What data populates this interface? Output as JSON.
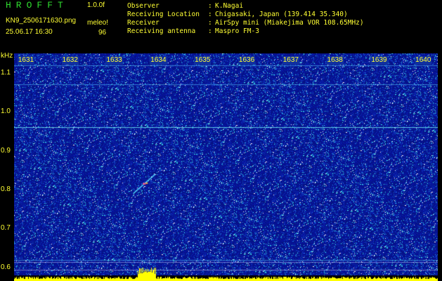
{
  "app": {
    "name": "HROFFT",
    "version": "1.0.0f"
  },
  "file": {
    "name": "KN9_2506171630.png",
    "timestamp": "25.06.17 16:30"
  },
  "mode": {
    "label": "meleo!",
    "count": "96"
  },
  "info": [
    {
      "label": "Observer",
      "value": "K.Nagai"
    },
    {
      "label": "Receiving Location",
      "value": "Chigasaki, Japan (139.414 35.340)"
    },
    {
      "label": "Receiver",
      "value": "AirSpy mini (Miakejima VOR 108.65MHz)"
    },
    {
      "label": "Receiving antenna",
      "value": "Maspro FM-3"
    }
  ],
  "colors": {
    "text": "#ffff33",
    "title": "#2fdc2f",
    "background": "#000000",
    "noise_base": "#0a1a8a",
    "baseline": "#ffff00"
  },
  "chart_data": {
    "type": "heatmap",
    "x_unit": "",
    "x_ticks": [
      "1631",
      "1632",
      "1633",
      "1634",
      "1635",
      "1636",
      "1637",
      "1638",
      "1639",
      "1640"
    ],
    "y_unit": "kHz",
    "y_ticks": [
      "1.1",
      "1.0",
      "0.9",
      "0.8",
      "0.7",
      "0.6"
    ],
    "ylim": [
      0.58,
      1.15
    ],
    "xlim": [
      1630.7,
      1640.3
    ],
    "horizontal_lines_khz": [
      1.12,
      1.07,
      0.96,
      0.62
    ],
    "meteor_echo": {
      "x_start": 1633.4,
      "x_end": 1633.9,
      "y_start": 0.79,
      "y_end": 0.84
    },
    "baseline_burst_x": [
      1633.5,
      1633.9
    ]
  }
}
